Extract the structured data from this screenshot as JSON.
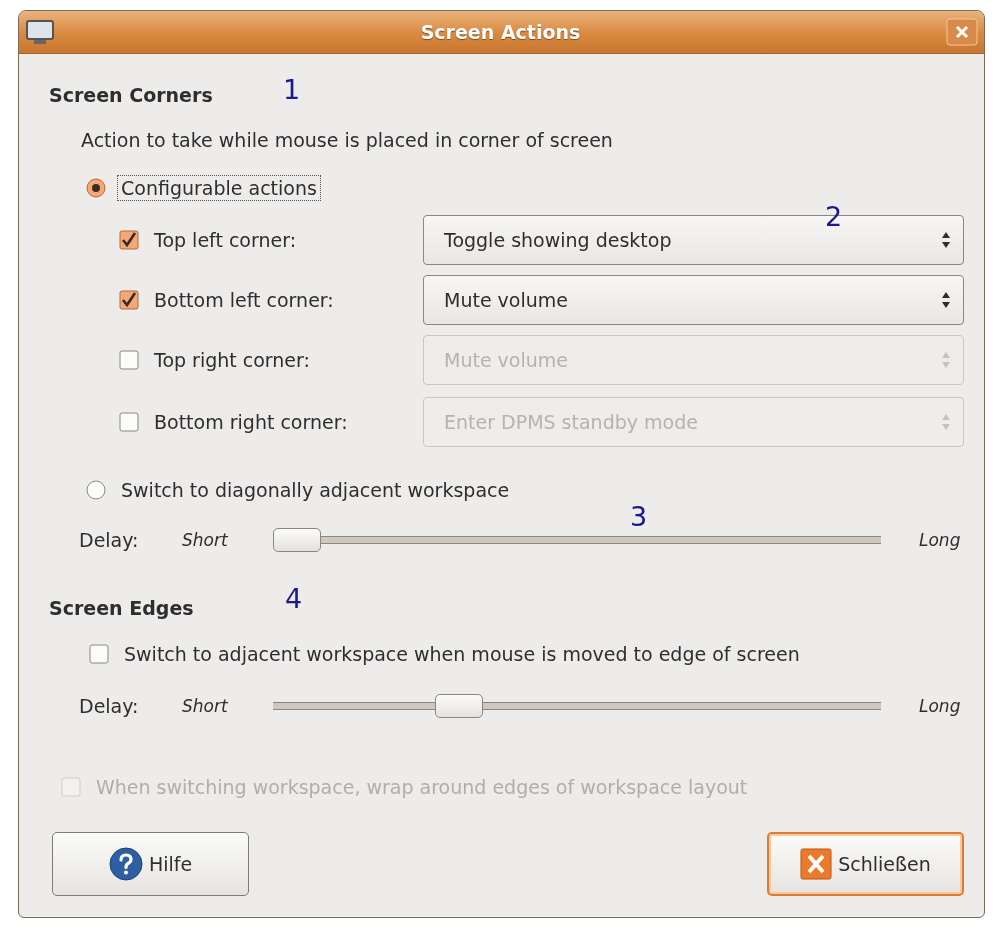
{
  "window": {
    "title": "Screen Actions"
  },
  "screen_corners": {
    "heading": "Screen Corners",
    "description": "Action to take while mouse is placed in corner of screen",
    "configurable": {
      "label": "Configurable actions",
      "selected": true,
      "focused": true
    },
    "corners": [
      {
        "label": "Top left corner:",
        "checked": true,
        "action": "Toggle showing desktop",
        "disabled": false
      },
      {
        "label": "Bottom left corner:",
        "checked": true,
        "action": "Mute volume",
        "disabled": false
      },
      {
        "label": "Top right corner:",
        "checked": false,
        "action": "Mute volume",
        "disabled": true
      },
      {
        "label": "Bottom right corner:",
        "checked": false,
        "action": "Enter DPMS standby mode",
        "disabled": true
      }
    ],
    "diagonal": {
      "label": "Switch to diagonally adjacent workspace",
      "selected": false
    },
    "delay": {
      "label": "Delay:",
      "short": "Short",
      "long": "Long",
      "level": 0
    }
  },
  "screen_edges": {
    "heading": "Screen Edges",
    "switch": {
      "label": "Switch to adjacent workspace when mouse is moved to edge of screen",
      "checked": false
    },
    "delay": {
      "label": "Delay:",
      "short": "Short",
      "long": "Long",
      "level": 0.29
    }
  },
  "wrap": {
    "label": "When switching workspace, wrap around edges of workspace layout",
    "checked": false,
    "disabled": true
  },
  "buttons": [
    {
      "label": "Hilfe",
      "kind": "help",
      "default": false
    },
    {
      "label": "Schließen",
      "kind": "close",
      "default": true
    }
  ],
  "annotations": [
    "1",
    "2",
    "3",
    "4"
  ]
}
